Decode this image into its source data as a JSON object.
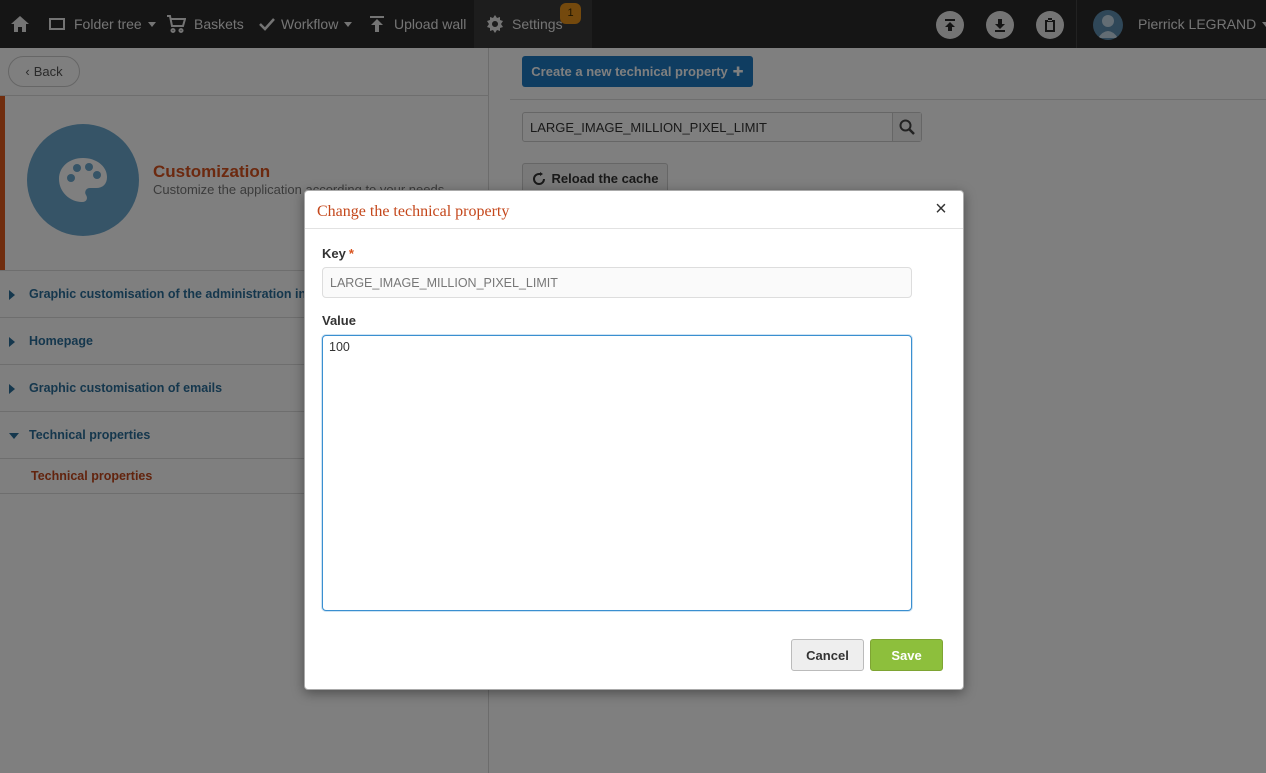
{
  "topbar": {
    "home_icon": "home-icon",
    "folder_tree": "Folder tree",
    "baskets": "Baskets",
    "workflow": "Workflow",
    "upload_wall": "Upload wall",
    "settings": "Settings",
    "settings_badge": "1",
    "user_name": "Pierrick LEGRAND"
  },
  "left_panel": {
    "back": "Back",
    "customization_title": "Customization",
    "customization_subtitle": "Customize the application according to your needs",
    "menu": [
      {
        "label": "Graphic customisation of the administration interface"
      },
      {
        "label": "Homepage"
      },
      {
        "label": "Graphic customisation of emails"
      },
      {
        "label": "Technical properties"
      }
    ],
    "submenu_active": "Technical properties"
  },
  "right_panel": {
    "create_button": "Create a new technical property",
    "search_value": "LARGE_IMAGE_MILLION_PIXEL_LIMIT",
    "reload_button": "Reload the cache"
  },
  "modal": {
    "title": "Change the technical property",
    "close": "×",
    "key_label": "Key",
    "required_marker": "*",
    "key_value": "LARGE_IMAGE_MILLION_PIXEL_LIMIT",
    "value_label": "Value",
    "value": "100",
    "cancel": "Cancel",
    "save": "Save"
  },
  "colors": {
    "topbar": "#2b2b2b",
    "accent_orange": "#d9531e",
    "link_blue": "#2a6e9a",
    "primary_blue": "#1f7ac2",
    "save_green": "#8dbf3c",
    "badge_orange": "#e8921a"
  }
}
